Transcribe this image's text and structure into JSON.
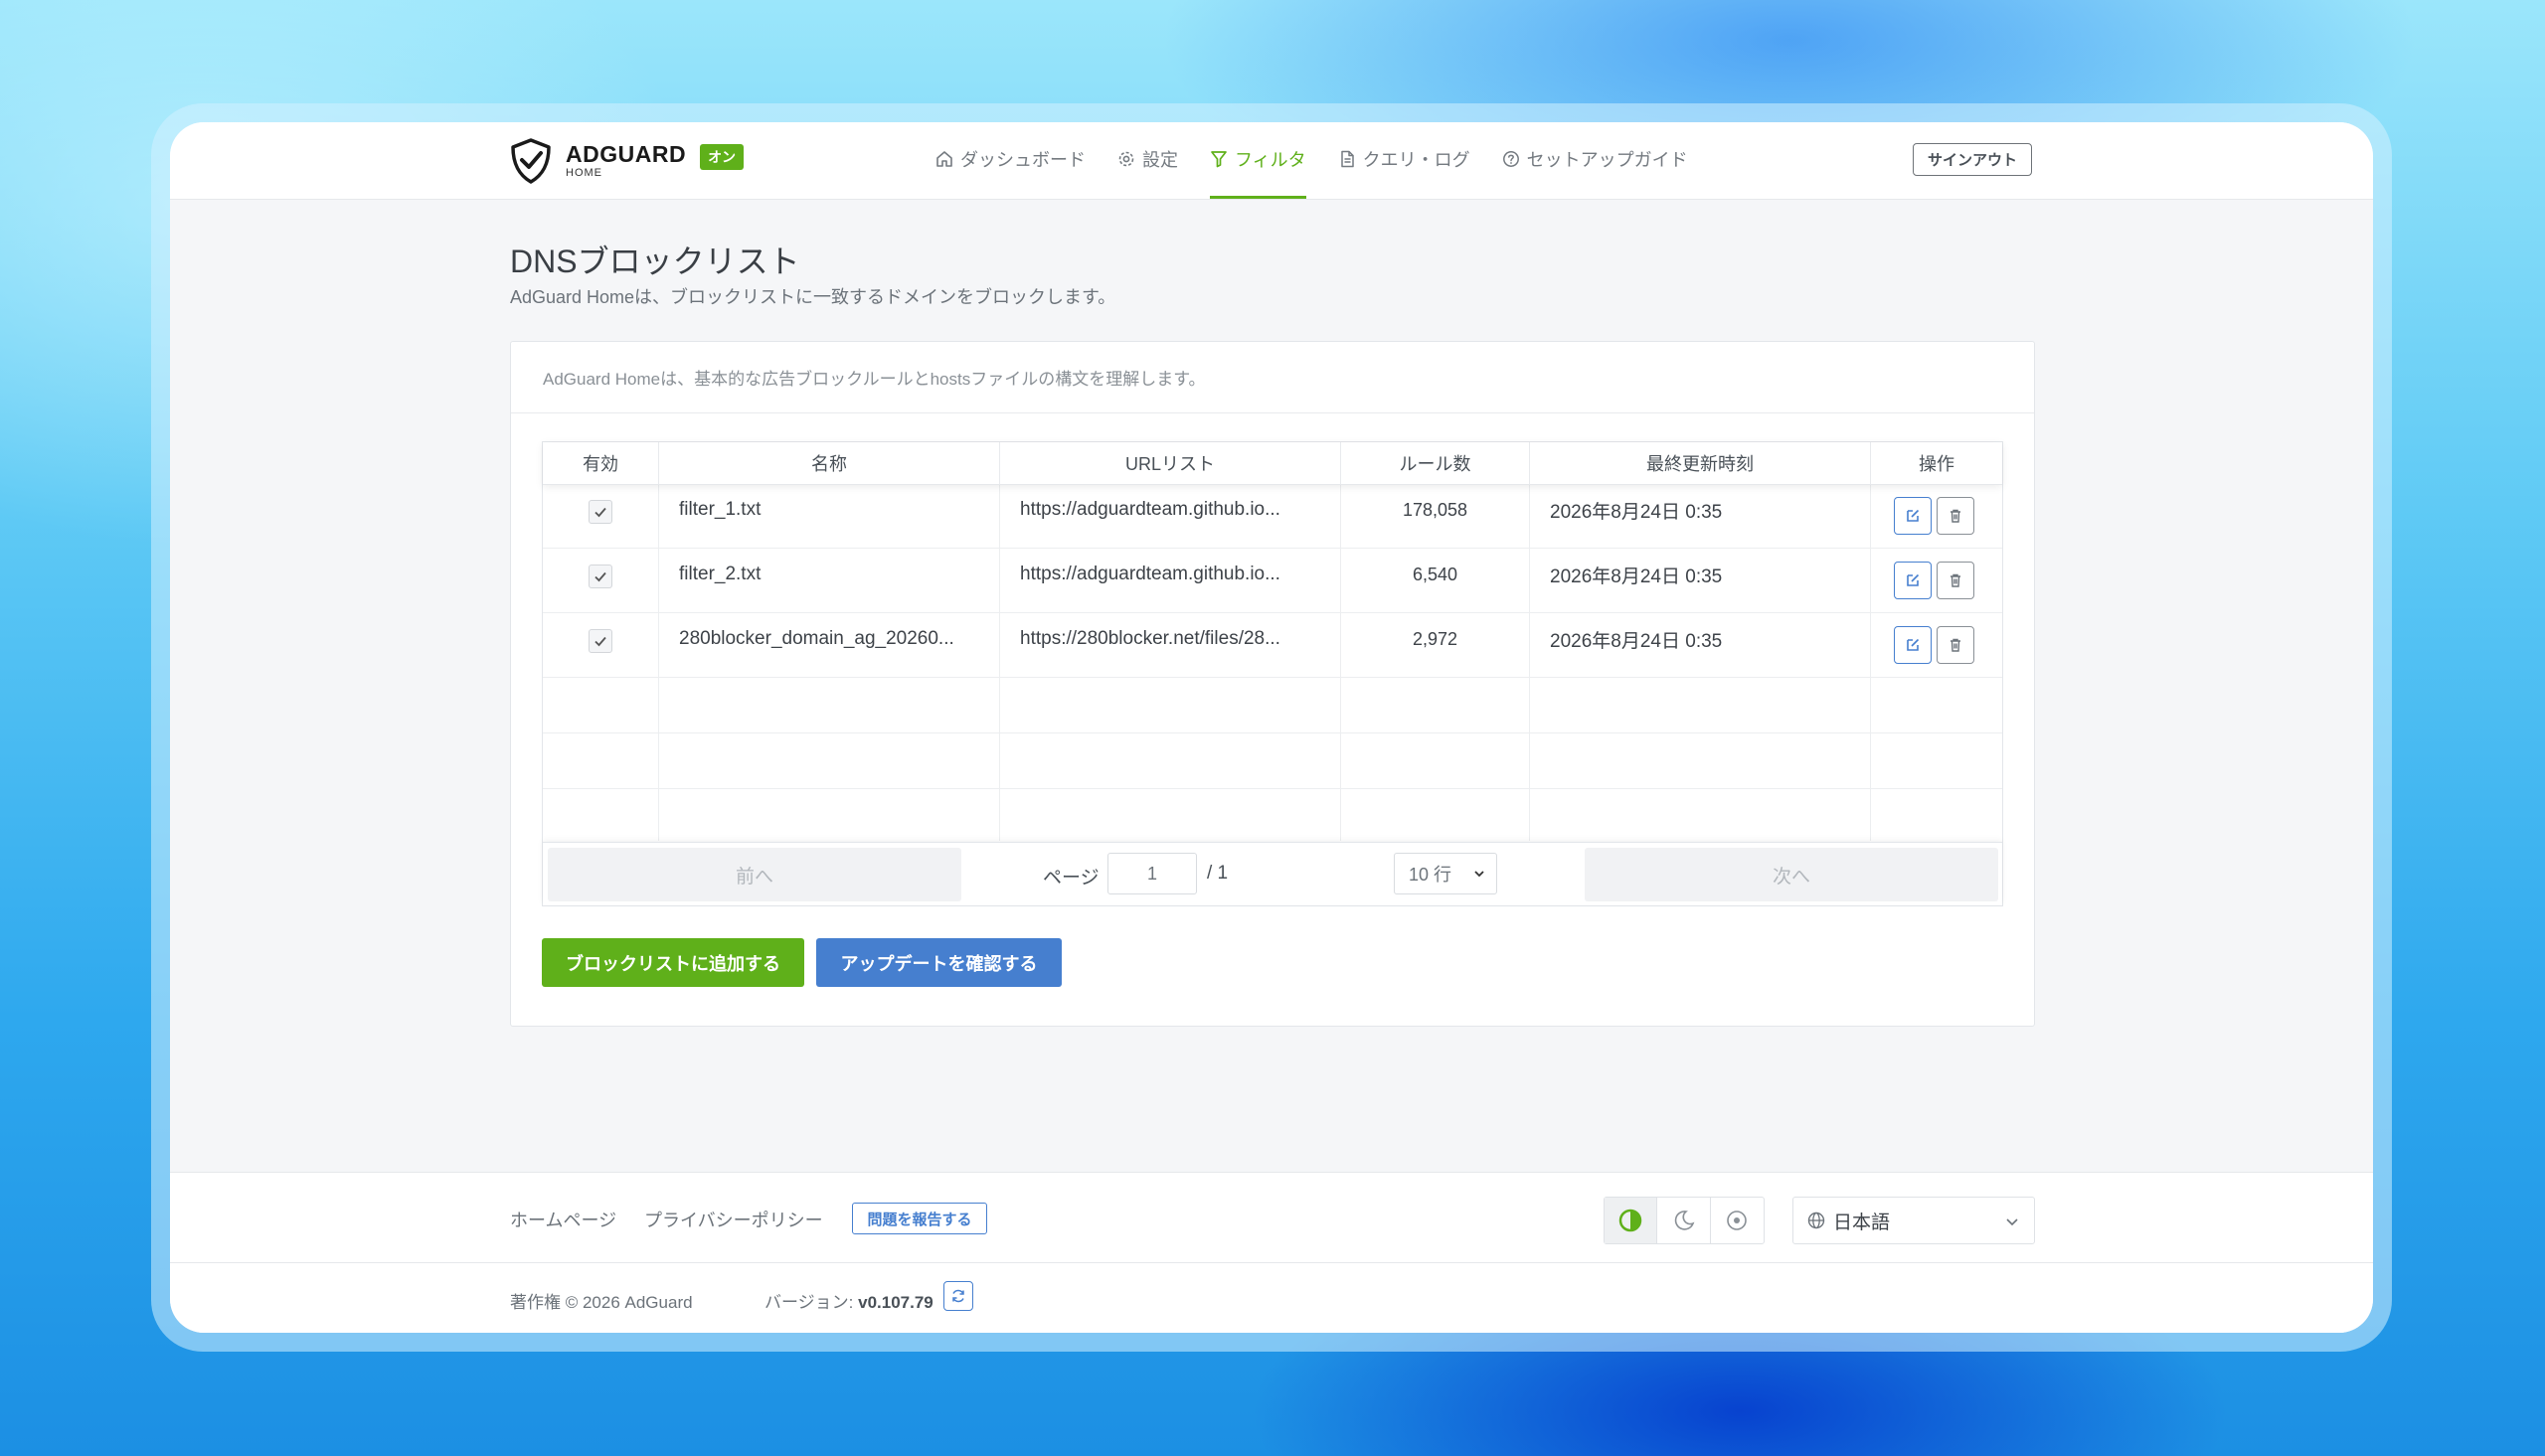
{
  "header": {
    "logo_main": "ADGUARD",
    "logo_sub": "HOME",
    "status_badge": "オン",
    "nav": [
      {
        "label": "ダッシュボード",
        "icon": "home-icon"
      },
      {
        "label": "設定",
        "icon": "gear-icon"
      },
      {
        "label": "フィルタ",
        "icon": "filter-icon",
        "active": true
      },
      {
        "label": "クエリ・ログ",
        "icon": "document-icon"
      },
      {
        "label": "セットアップガイド",
        "icon": "help-circle-icon"
      }
    ],
    "signout": "サインアウト"
  },
  "page": {
    "title": "DNSブロックリスト",
    "subtitle": "AdGuard Homeは、ブロックリストに一致するドメインをブロックします。"
  },
  "card": {
    "description": "AdGuard Homeは、基本的な広告ブロックルールとhostsファイルの構文を理解します。"
  },
  "table": {
    "columns": [
      "有効",
      "名称",
      "URLリスト",
      "ルール数",
      "最終更新時刻",
      "操作"
    ],
    "rows": [
      {
        "enabled": true,
        "name": "filter_1.txt",
        "url": "https://adguardteam.github.io...",
        "rules": "178,058",
        "updated": "2026年8月24日 0:35"
      },
      {
        "enabled": true,
        "name": "filter_2.txt",
        "url": "https://adguardteam.github.io...",
        "rules": "6,540",
        "updated": "2026年8月24日 0:35"
      },
      {
        "enabled": true,
        "name": "280blocker_domain_ag_20260...",
        "url": "https://280blocker.net/files/28...",
        "rules": "2,972",
        "updated": "2026年8月24日 0:35"
      }
    ]
  },
  "pagination": {
    "prev": "前へ",
    "page_label": "ページ",
    "page_value": "1",
    "total": "/ 1",
    "rows_per_page": "10 行",
    "next": "次へ"
  },
  "actions": {
    "add_blocklist": "ブロックリストに追加する",
    "check_updates": "アップデートを確認する"
  },
  "footer": {
    "homepage": "ホームページ",
    "privacy": "プライバシーポリシー",
    "report": "問題を報告する",
    "theme_options": [
      "auto-theme-icon",
      "dark-theme-icon",
      "light-theme-icon"
    ],
    "language": "日本語",
    "copyright": "著作権 © 2026 AdGuard",
    "version_label": "バージョン: ",
    "version": "v0.107.79"
  },
  "colors": {
    "accent_green": "#5fb01a",
    "accent_blue": "#467fcf"
  }
}
